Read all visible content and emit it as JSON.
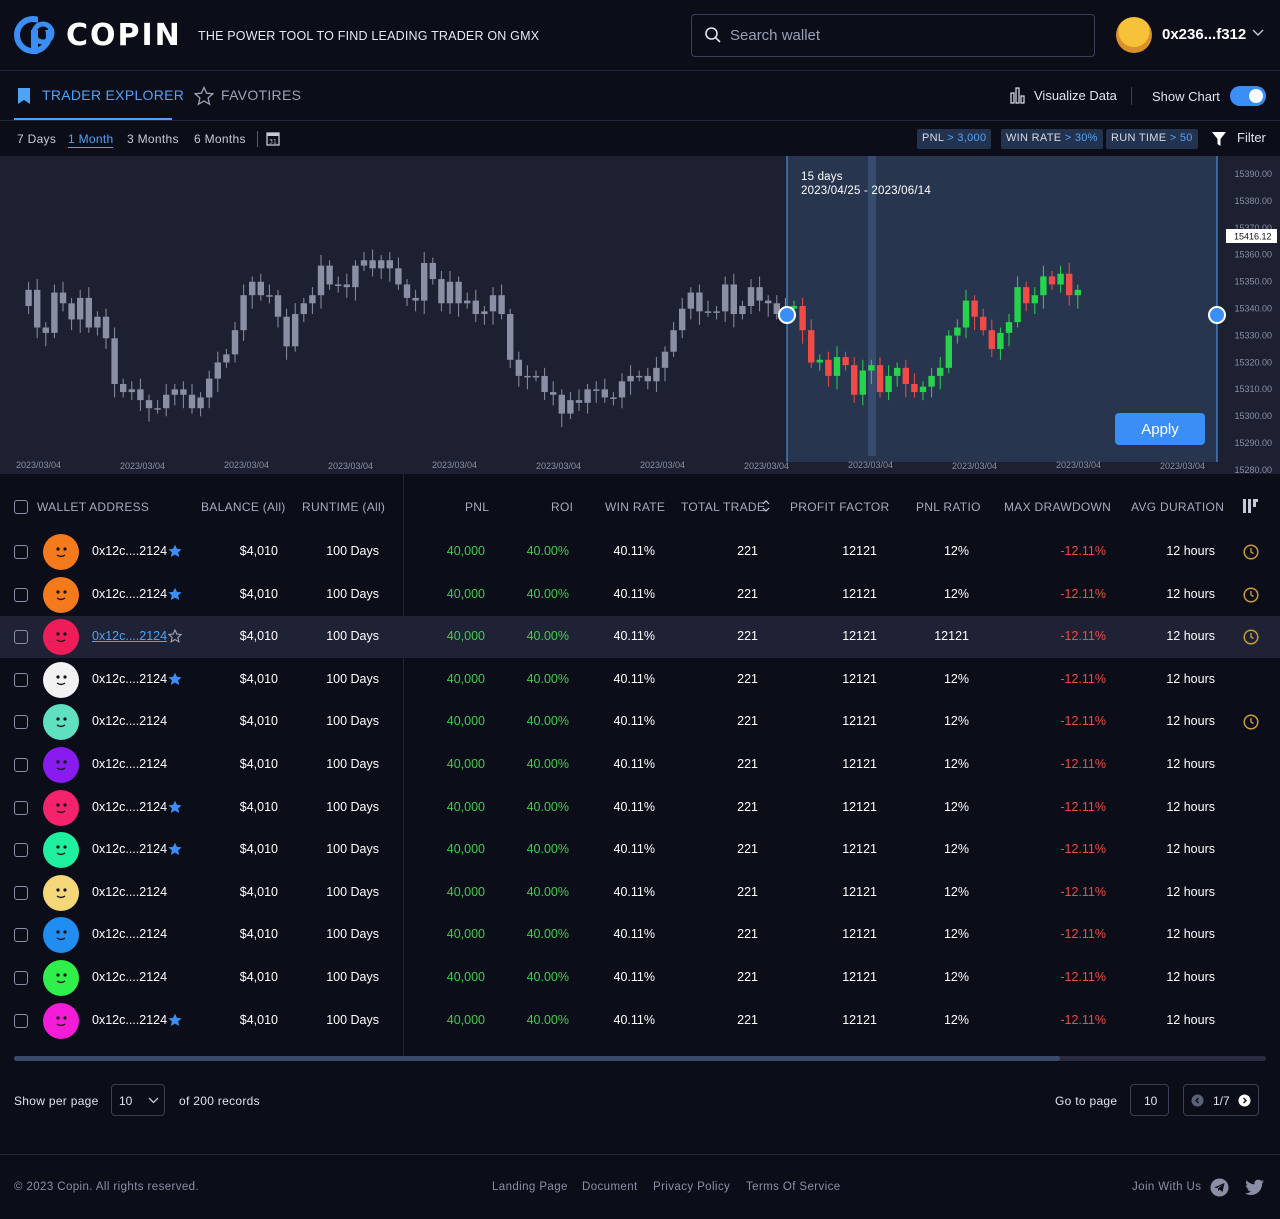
{
  "header": {
    "logo_text": "COPIN",
    "tagline": "THE POWER TOOL TO FIND LEADING TRADER ON GMX",
    "search_placeholder": "Search wallet",
    "account_address": "0x236...f312"
  },
  "tabs": {
    "explorer": "TRADER EXPLORER",
    "favorites": "FAVOTIRES",
    "visualize": "Visualize Data",
    "show_chart": "Show Chart",
    "show_chart_on": true
  },
  "periods": {
    "items": [
      "7 Days",
      "1 Month",
      "3 Months",
      "6 Months"
    ],
    "selected": "1 Month"
  },
  "filters": {
    "pnl": {
      "label": "PNL",
      "op": ">",
      "value": "3,000"
    },
    "win_rate": {
      "label": "WIN RATE",
      "op": ">",
      "value": "30%"
    },
    "run_time": {
      "label": "RUN TIME",
      "op": ">",
      "value": "50"
    },
    "button": "Filter"
  },
  "chart": {
    "selection_duration": "15 days",
    "selection_range": "2023/04/25 - 2023/06/14",
    "current_price": "15416.12",
    "y_ticks": [
      "15390.00",
      "15380.00",
      "15370.00",
      "15360.00",
      "15350.00",
      "15340.00",
      "15330.00",
      "15320.00",
      "15310.00",
      "15300.00",
      "15290.00",
      "15280.00"
    ],
    "x_ticks": [
      "2023/03/04",
      "2023/03/04",
      "2023/03/04",
      "2023/03/04",
      "2023/03/04",
      "2023/03/04",
      "2023/03/04",
      "2023/03/04",
      "2023/03/04",
      "2023/03/04",
      "2023/03/04",
      "2023/03/04"
    ],
    "apply": "Apply"
  },
  "table": {
    "headers": {
      "wallet": "WALLET ADDRESS",
      "balance": "BALANCE (All)",
      "runtime": "RUNTIME (All)",
      "pnl": "PNL",
      "roi": "ROI",
      "win_rate": "WIN RATE",
      "total_trade": "TOTAL TRADE",
      "profit_factor": "PROFIT FACTOR",
      "pnl_ratio": "PNL RATIO",
      "max_drawdown": "MAX DRAWDOWN",
      "avg_duration": "AVG DURATION"
    },
    "rows": [
      {
        "addr": "0x12c....2124",
        "fav": true,
        "balance": "$4,010",
        "runtime": "100 Days",
        "pnl": "40,000",
        "roi": "40.00%",
        "win": "40.11%",
        "trades": "221",
        "pf": "12121",
        "ratio": "12%",
        "dd": "-12.11%",
        "dur": "12 hours",
        "clock": true,
        "color": "#f57a1c"
      },
      {
        "addr": "0x12c....2124",
        "fav": true,
        "balance": "$4,010",
        "runtime": "100 Days",
        "pnl": "40,000",
        "roi": "40.00%",
        "win": "40.11%",
        "trades": "221",
        "pf": "12121",
        "ratio": "12%",
        "dd": "-12.11%",
        "dur": "12 hours",
        "clock": true,
        "color": "#f57a1c"
      },
      {
        "addr": "0x12c....2124",
        "fav": false,
        "balance": "$4,010",
        "runtime": "100 Days",
        "pnl": "40,000",
        "roi": "40.00%",
        "win": "40.11%",
        "trades": "221",
        "pf": "12121",
        "ratio": "12121",
        "dd": "-12.11%",
        "dur": "12 hours",
        "clock": true,
        "color": "#f01c5a",
        "highlight": true
      },
      {
        "addr": "0x12c....2124",
        "fav": true,
        "balance": "$4,010",
        "runtime": "100 Days",
        "pnl": "40,000",
        "roi": "40.00%",
        "win": "40.11%",
        "trades": "221",
        "pf": "12121",
        "ratio": "12%",
        "dd": "-12.11%",
        "dur": "12 hours",
        "clock": false,
        "color": "#f2f2f2"
      },
      {
        "addr": "0x12c....2124",
        "fav": false,
        "balance": "$4,010",
        "runtime": "100 Days",
        "pnl": "40,000",
        "roi": "40.00%",
        "win": "40.11%",
        "trades": "221",
        "pf": "12121",
        "ratio": "12%",
        "dd": "-12.11%",
        "dur": "12 hours",
        "clock": true,
        "color": "#5fe0c0"
      },
      {
        "addr": "0x12c....2124",
        "fav": false,
        "balance": "$4,010",
        "runtime": "100 Days",
        "pnl": "40,000",
        "roi": "40.00%",
        "win": "40.11%",
        "trades": "221",
        "pf": "12121",
        "ratio": "12%",
        "dd": "-12.11%",
        "dur": "12 hours",
        "clock": false,
        "color": "#8a1bf0"
      },
      {
        "addr": "0x12c....2124",
        "fav": true,
        "balance": "$4,010",
        "runtime": "100 Days",
        "pnl": "40,000",
        "roi": "40.00%",
        "win": "40.11%",
        "trades": "221",
        "pf": "12121",
        "ratio": "12%",
        "dd": "-12.11%",
        "dur": "12 hours",
        "clock": false,
        "color": "#f5236b"
      },
      {
        "addr": "0x12c....2124",
        "fav": true,
        "balance": "$4,010",
        "runtime": "100 Days",
        "pnl": "40,000",
        "roi": "40.00%",
        "win": "40.11%",
        "trades": "221",
        "pf": "12121",
        "ratio": "12%",
        "dd": "-12.11%",
        "dur": "12 hours",
        "clock": false,
        "color": "#1ff0a0"
      },
      {
        "addr": "0x12c....2124",
        "fav": false,
        "balance": "$4,010",
        "runtime": "100 Days",
        "pnl": "40,000",
        "roi": "40.00%",
        "win": "40.11%",
        "trades": "221",
        "pf": "12121",
        "ratio": "12%",
        "dd": "-12.11%",
        "dur": "12 hours",
        "clock": false,
        "color": "#f5d77a"
      },
      {
        "addr": "0x12c....2124",
        "fav": false,
        "balance": "$4,010",
        "runtime": "100 Days",
        "pnl": "40,000",
        "roi": "40.00%",
        "win": "40.11%",
        "trades": "221",
        "pf": "12121",
        "ratio": "12%",
        "dd": "-12.11%",
        "dur": "12 hours",
        "clock": false,
        "color": "#1f8ef0"
      },
      {
        "addr": "0x12c....2124",
        "fav": false,
        "balance": "$4,010",
        "runtime": "100 Days",
        "pnl": "40,000",
        "roi": "40.00%",
        "win": "40.11%",
        "trades": "221",
        "pf": "12121",
        "ratio": "12%",
        "dd": "-12.11%",
        "dur": "12 hours",
        "clock": false,
        "color": "#2ff04a"
      },
      {
        "addr": "0x12c....2124",
        "fav": true,
        "balance": "$4,010",
        "runtime": "100 Days",
        "pnl": "40,000",
        "roi": "40.00%",
        "win": "40.11%",
        "trades": "221",
        "pf": "12121",
        "ratio": "12%",
        "dd": "-12.11%",
        "dur": "12 hours",
        "clock": false,
        "color": "#f51cd8"
      }
    ]
  },
  "pager": {
    "show_per_page": "Show per page",
    "per_page": "10",
    "records": "of 200 records",
    "go_to_page": "Go to page",
    "page_input": "10",
    "page_status": "1/7"
  },
  "footer": {
    "copyright": "© 2023 Copin. All rights reserved.",
    "links": [
      "Landing Page",
      "Document",
      "Privacy Policy",
      "Terms Of Service"
    ],
    "join": "Join With Us"
  },
  "colors": {
    "accent": "#3a8ef6",
    "positive": "#3fcf4c",
    "negative": "#f04b47",
    "background": "#0b0d19"
  }
}
